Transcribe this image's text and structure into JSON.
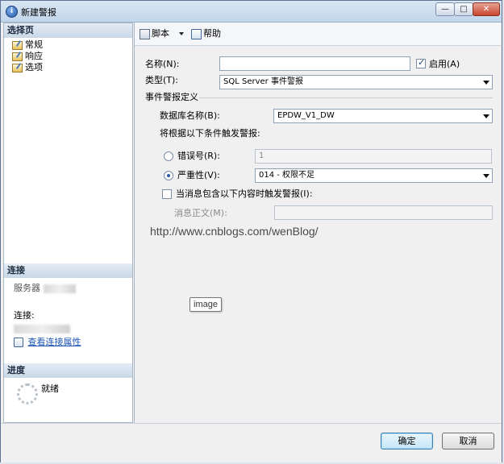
{
  "window": {
    "title": "新建警报",
    "min": "—",
    "max": "□",
    "close": "✕"
  },
  "left_panel": {
    "select_page_header": "选择页",
    "pages": [
      "常规",
      "响应",
      "选项"
    ],
    "connection_header": "连接",
    "server_label": "服务器",
    "connection_label": "连接:",
    "view_connection_link": "查看连接属性",
    "progress_header": "进度",
    "progress_status": "就绪"
  },
  "toolbar": {
    "script_label": "脚本",
    "help_label": "帮助"
  },
  "form": {
    "name_label": "名称(N):",
    "name_value": "",
    "enabled_label": "启用(A)",
    "enabled_checked": true,
    "type_label": "类型(T):",
    "type_value": "SQL Server 事件警报",
    "definition_group": "事件警报定义",
    "database_label": "数据库名称(B):",
    "database_value": "EPDW_V1_DW",
    "trigger_label": "将根据以下条件触发警报:",
    "error_number_label": "错误号(R):",
    "error_number_value": "1",
    "error_selected": false,
    "severity_label": "严重性(V):",
    "severity_value": "014 - 权限不足",
    "severity_selected": true,
    "message_checkbox_label": "当消息包含以下内容时触发警报(I):",
    "message_checked": false,
    "message_text_label": "消息正文(M):",
    "message_text_value": ""
  },
  "watermark": "http://www.cnblogs.com/wenBlog/",
  "tooltip": "image",
  "buttons": {
    "ok": "确定",
    "cancel": "取消"
  }
}
